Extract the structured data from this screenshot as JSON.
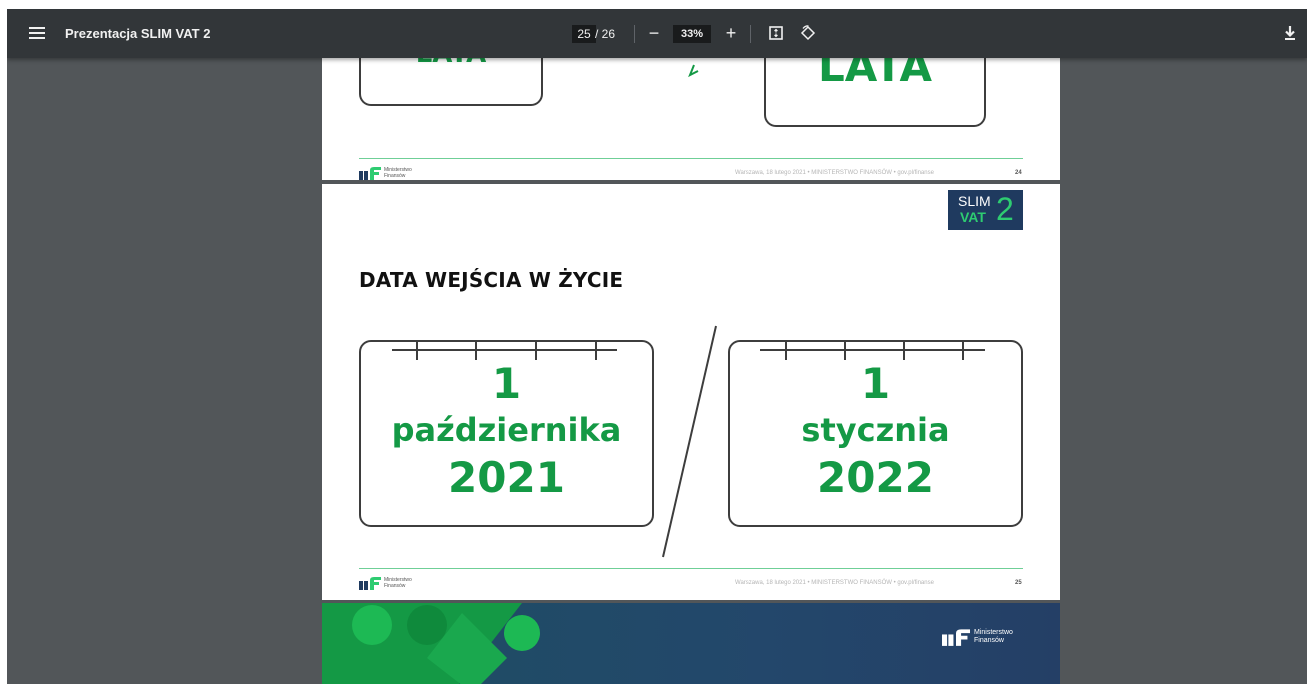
{
  "toolbar": {
    "title": "Prezentacja SLIM VAT 2",
    "current_page": "25",
    "total_pages": "/ 26",
    "zoom": "33%",
    "zoom_out_label": "−",
    "zoom_in_label": "+",
    "icons": [
      "menu-icon",
      "zoom-out-icon",
      "zoom-in-icon",
      "fit-page-icon",
      "rotate-icon",
      "download-icon"
    ]
  },
  "page24": {
    "partial_left": "LATA",
    "partial_right": "LATA",
    "footer_logo": "Ministerstwo\nFinansów",
    "footer_text": "Warszawa, 18 lutego 2021   •   MINISTERSTWO FINANSÓW   •   gov.pl/finanse",
    "page_number": "24"
  },
  "page25": {
    "badge_line1": "SLIM",
    "badge_line2": "VAT",
    "badge_digit": "2",
    "heading": "DATA WEJŚCIA W ŻYCIE",
    "left_day": "1",
    "left_month": "października",
    "left_year": "2021",
    "right_day": "1",
    "right_month": "stycznia",
    "right_year": "2022",
    "footer_logo": "Ministerstwo\nFinansów",
    "footer_text": "Warszawa, 18 lutego 2021   •   MINISTERSTWO FINANSÓW   •   gov.pl/finanse",
    "page_number": "25"
  },
  "page26": {
    "logo_text": "Ministerstwo\nFinansów"
  },
  "colors": {
    "toolbar": "#323639",
    "viewer_bg": "#525659",
    "accent_green": "#149945",
    "badge_navy": "#1f3a5f"
  }
}
